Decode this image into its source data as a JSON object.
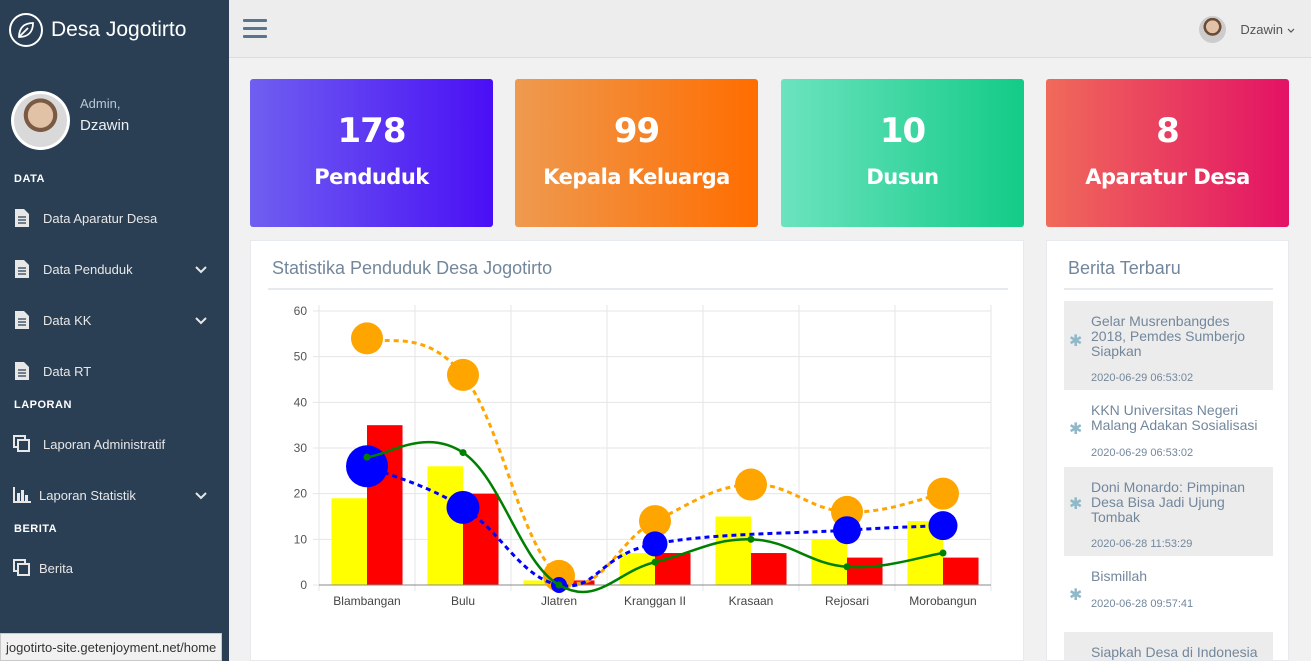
{
  "app": {
    "title": "Desa Jogotirto"
  },
  "profile": {
    "welcome": "Admin,",
    "name": "Dzawin"
  },
  "sidebar": {
    "sections": [
      {
        "title": "DATA",
        "items": [
          {
            "label": "Data Aparatur Desa",
            "icon": "file-icon",
            "has_children": false
          },
          {
            "label": "Data Penduduk",
            "icon": "file-icon",
            "has_children": true
          },
          {
            "label": "Data KK",
            "icon": "file-icon",
            "has_children": true
          },
          {
            "label": "Data RT",
            "icon": "file-icon",
            "has_children": false
          }
        ]
      },
      {
        "title": "LAPORAN",
        "items": [
          {
            "label": "Laporan Administratif",
            "icon": "copy-icon",
            "has_children": false
          },
          {
            "label": "Laporan Statistik",
            "icon": "bar-chart-icon",
            "has_children": true
          }
        ]
      },
      {
        "title": "BERITA",
        "items": [
          {
            "label": "Berita",
            "icon": "copy-icon",
            "has_children": false
          }
        ]
      }
    ]
  },
  "topnav": {
    "user_name": "Dzawin"
  },
  "tiles": [
    {
      "value": "178",
      "label": "Penduduk",
      "color_from": "#6f5ff0",
      "color_to": "#4a0ff5"
    },
    {
      "value": "99",
      "label": "Kepala Keluarga",
      "color_from": "#ee9a50",
      "color_to": "#ff6d00"
    },
    {
      "value": "10",
      "label": "Dusun",
      "color_from": "#6ce3be",
      "color_to": "#13cb87"
    },
    {
      "value": "8",
      "label": "Aparatur Desa",
      "color_from": "#f06a5a",
      "color_to": "#e31265"
    }
  ],
  "chart_panel": {
    "title": "Statistika Penduduk Desa Jogotirto"
  },
  "chart_data": {
    "type": "bar",
    "categories": [
      "Blambangan",
      "Bulu",
      "Jlatren",
      "Kranggan II",
      "Krasaan",
      "Rejosari",
      "Morobangun"
    ],
    "ylim": [
      0,
      60
    ],
    "yticks": [
      0,
      10,
      20,
      30,
      40,
      50,
      60
    ],
    "grid": true,
    "bar_series": [
      {
        "color": "#ffff00",
        "values": [
          19,
          26,
          1,
          7,
          15,
          10,
          14
        ]
      },
      {
        "color": "#ff0000",
        "values": [
          35,
          20,
          1,
          7,
          7,
          6,
          6
        ]
      }
    ],
    "line_series": [
      {
        "color": "#ffa500",
        "style": "dashed",
        "marker": "bubble",
        "values": [
          54,
          46,
          2,
          14,
          22,
          16,
          20
        ]
      },
      {
        "color": "#0000ff",
        "style": "dashed",
        "marker": "bubble",
        "values": [
          26,
          17,
          0,
          9,
          null,
          12,
          13
        ]
      },
      {
        "color": "#008000",
        "style": "solid",
        "marker": "dot",
        "values": [
          28,
          29,
          0,
          5,
          10,
          4,
          7
        ]
      }
    ]
  },
  "news_panel": {
    "title": "Berita Terbaru",
    "items": [
      {
        "title": "Gelar Musrenbangdes 2018, Pemdes Sumberjo Siapkan",
        "date": "2020-06-29 06:53:02"
      },
      {
        "title": "KKN Universitas Negeri Malang Adakan Sosialisasi",
        "date": "2020-06-29 06:53:02"
      },
      {
        "title": "Doni Monardo: Pimpinan Desa Bisa Jadi Ujung Tombak",
        "date": "2020-06-28 11:53:29"
      },
      {
        "title": "Bismillah",
        "date": "2020-06-28 09:57:41"
      },
      {
        "title": "Siapkah Desa di Indonesia",
        "date": ""
      }
    ]
  },
  "status_bar": {
    "url": "jogotirto-site.getenjoyment.net/home"
  }
}
